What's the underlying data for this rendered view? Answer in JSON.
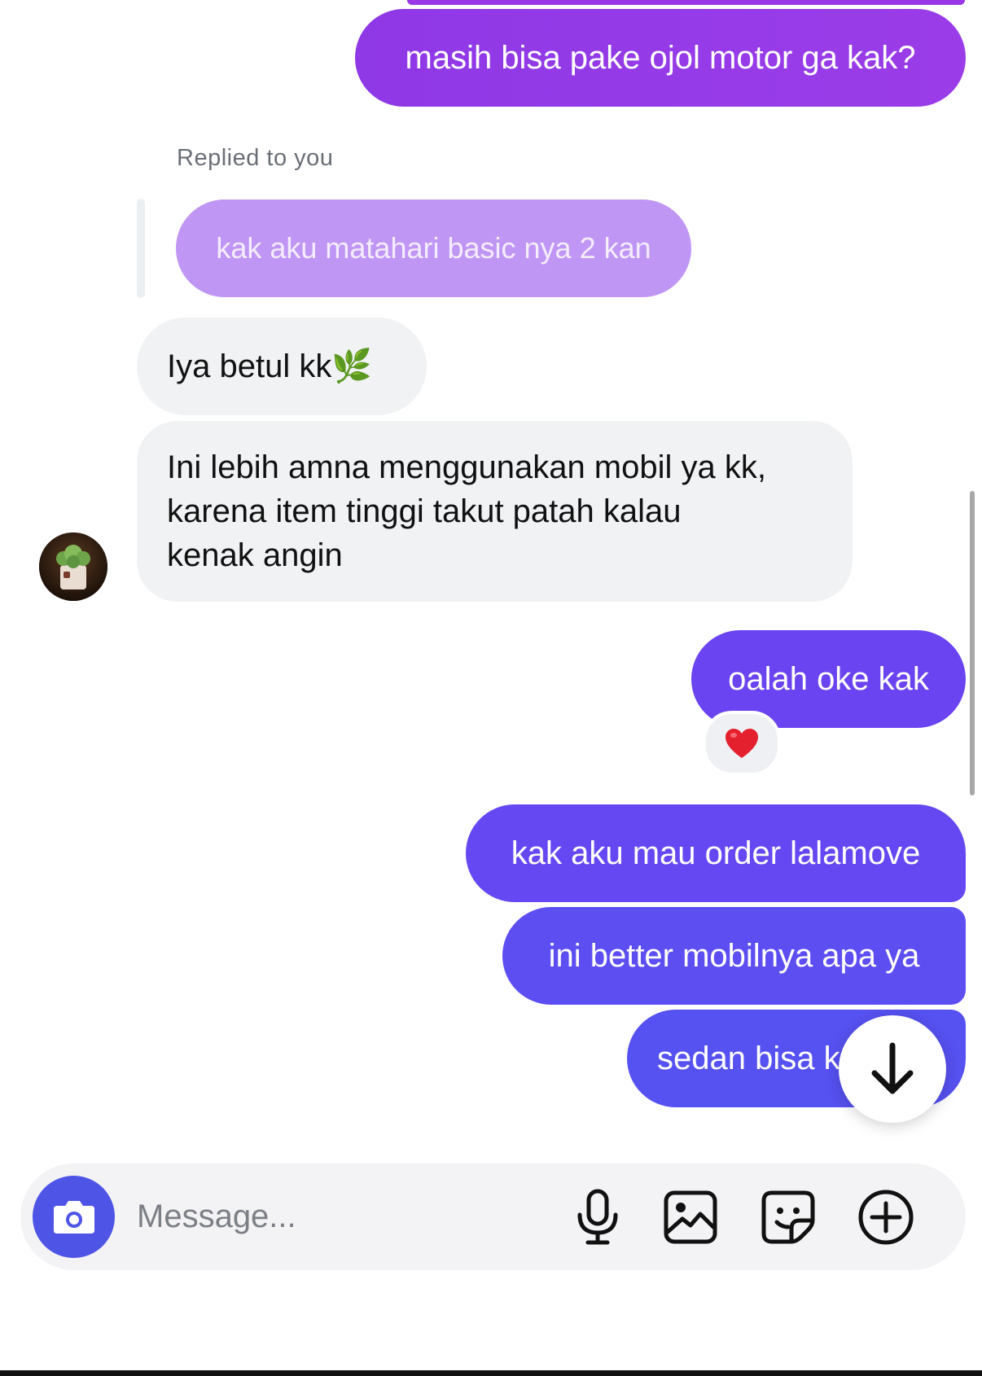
{
  "thread": {
    "replied_label": "Replied to you",
    "quoted_message": "kak aku matahari basic nya 2 kan",
    "messages": [
      {
        "text": "masih bisa pake ojol motor ga kak?",
        "direction": "sent",
        "color": "#9538E5"
      },
      {
        "text": "Iya betul kk🌿",
        "direction": "received"
      },
      {
        "lines": [
          "Ini lebih amna menggunakan mobil ya kk,",
          "karena item tinggi takut patah kalau",
          "kenak angin"
        ],
        "direction": "received"
      },
      {
        "text": "oalah oke kak",
        "direction": "sent",
        "color": "#6A44F0",
        "reaction": "❤️"
      },
      {
        "text": "kak aku mau order lalamove",
        "direction": "sent",
        "color": "#6648F2"
      },
      {
        "text": "ini better mobilnya apa ya",
        "direction": "sent",
        "color": "#5D4EF2"
      },
      {
        "text": "sedan bisa k",
        "direction": "sent",
        "color": "#5651F1"
      }
    ]
  },
  "composer": {
    "placeholder": "Message...",
    "camera_icon": "camera-icon",
    "tools": [
      "microphone-icon",
      "image-icon",
      "sticker-icon",
      "plus-circle-icon"
    ]
  },
  "colors": {
    "quoted_bubble": "#C096F5",
    "received_bubble": "#F0F2F4",
    "camera_button": "#4E54E6"
  }
}
